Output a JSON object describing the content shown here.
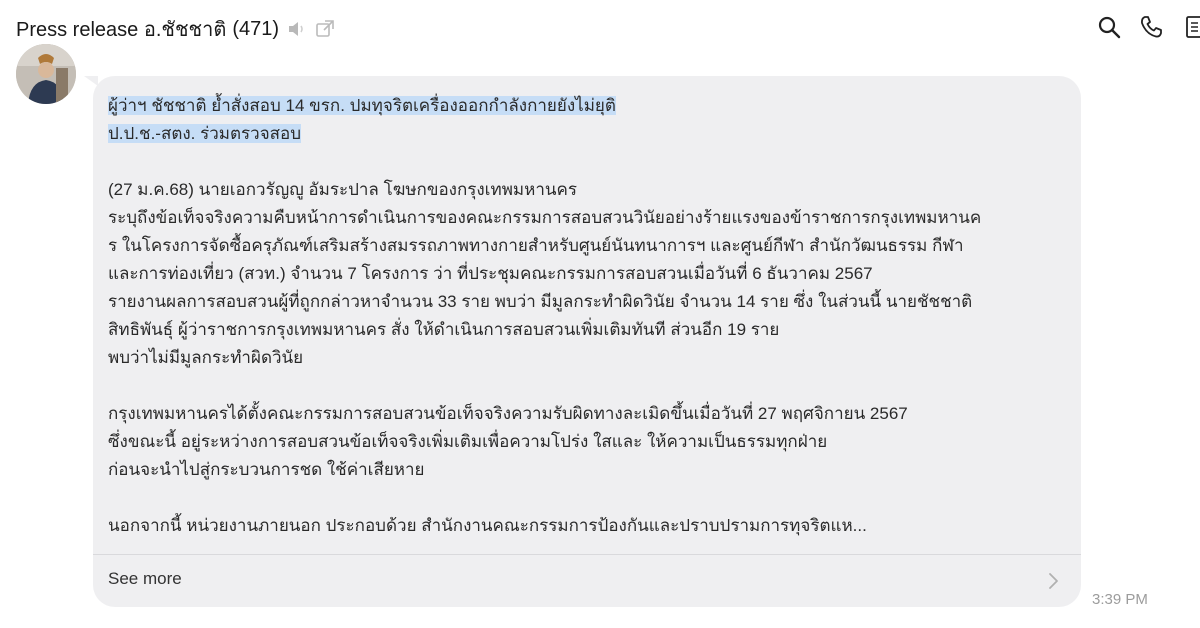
{
  "header": {
    "title": "Press release อ.ชัชชาติ",
    "count": "(471)",
    "icons": [
      "speaker-muted-icon",
      "external-link-icon",
      "search-icon",
      "phone-icon",
      "notes-icon"
    ]
  },
  "message": {
    "highlight_lines": [
      "ผู้ว่าฯ ชัชชาติ ย้ำสั่งสอบ 14 ขรก. ปมทุจริตเครื่องออกกำลังกายยังไม่ยุติ",
      "ป.ป.ช.-สตง. ร่วมตรวจสอบ"
    ],
    "para1_lines": [
      "(27 ม.ค.68) นายเอกวรัญญู อัมระปาล โฆษกของกรุงเทพมหานคร",
      "ระบุถึงข้อเท็จจริงความคืบหน้าการดำเนินการของคณะกรรมการสอบสวนวินัยอย่างร้ายแรงของข้าราชการกรุงเทพมหานค",
      "ร ในโครงการจัดซื้อครุภัณฑ์เสริมสร้างสมรรถภาพทางกายสำหรับศูนย์นันทนาการฯ และศูนย์กีฬา สำนักวัฒนธรรม กีฬา",
      "และการท่องเที่ยว (สวท.) จำนวน 7 โครงการ ว่า  ที่ประชุมคณะกรรมการสอบสวนเมื่อวันที่ 6 ธันวาคม 2567",
      "รายงานผลการสอบสวนผู้ที่ถูกกล่าวหาจำนวน 33 ราย พบว่า มีมูลกระทำผิดวินัย จำนวน 14 ราย ซึ่ง ในส่วนนี้ นายชัชชาติ",
      "สิทธิพันธุ์ ผู้ว่าราชการกรุงเทพมหานคร สั่ง ให้ดำเนินการสอบสวนเพิ่มเติมทันที ส่วนอีก 19 ราย",
      "พบว่าไม่มีมูลกระทำผิดวินัย"
    ],
    "para2_lines": [
      "กรุงเทพมหานครได้ตั้งคณะกรรมการสอบสวนข้อเท็จจริงความรับผิดทางละเมิดขึ้นเมื่อวันที่ 27 พฤศจิกายน 2567",
      "ซึ่งขณะนี้ อยู่ระหว่างการสอบสวนข้อเท็จจริงเพิ่มเติมเพื่อความโปร่ง ใสและ ให้ความเป็นธรรมทุกฝ่าย",
      "ก่อนจะนำไปสู่กระบวนการชด ใช้ค่าเสียหาย"
    ],
    "para3_lines": [
      "นอกจากนี้ หน่วยงานภายนอก ประกอบด้วย สำนักงานคณะกรรมการป้องกันและปราบปรามการทุจริตแห..."
    ],
    "see_more": "See more",
    "timestamp": "3:39 PM"
  },
  "colors": {
    "bubble": "#efeff1",
    "highlight": "#c6ddf6",
    "timestamp": "#9c9c9c"
  }
}
